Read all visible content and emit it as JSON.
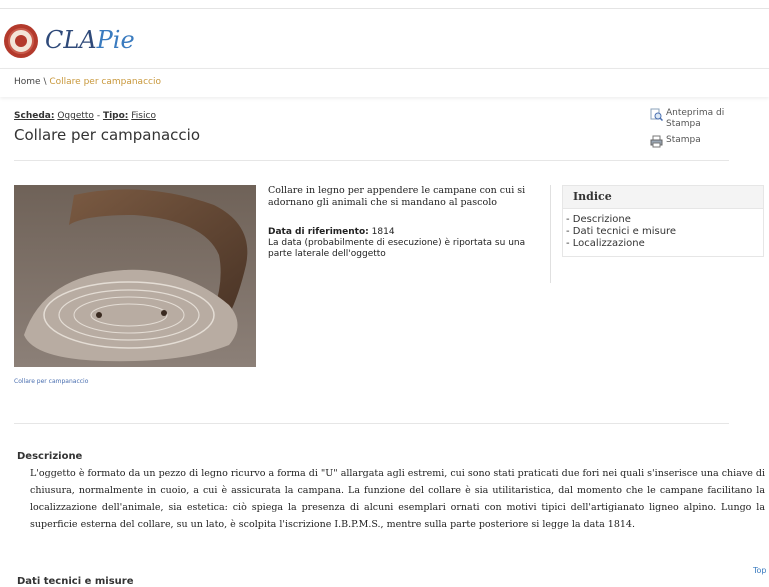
{
  "header": {
    "brand_prefix": "CLA",
    "brand_suffix": "Pie"
  },
  "breadcrumb": {
    "home": "Home",
    "separator": "\\",
    "current": "Collare per campanaccio"
  },
  "record": {
    "scheda_label": "Scheda:",
    "scheda_value": "Oggetto",
    "dash": "-",
    "tipo_label": "Tipo:",
    "tipo_value": "Fisico",
    "title": "Collare per campanaccio"
  },
  "actions": {
    "preview": "Anteprima di Stampa",
    "print": "Stampa"
  },
  "image": {
    "caption": "Collare per campanaccio"
  },
  "summary": {
    "description": "Collare in legno per appendere le campane con cui si adornano gli animali che si mandano al pascolo",
    "date_label": "Data di riferimento:",
    "date_value": "1814",
    "date_note": "La data (probabilmente di esecuzione) è riportata su una parte laterale dell'oggetto"
  },
  "index": {
    "title": "Indice",
    "items": [
      "- Descrizione",
      "- Dati tecnici e misure",
      "- Localizzazione"
    ]
  },
  "sections": {
    "descrizione_title": "Descrizione",
    "descrizione_body": "L'oggetto è formato da un pezzo di legno ricurvo a forma di \"U\" allargata agli estremi, cui sono stati praticati due fori nei quali s'inserisce una chiave di chiusura, normalmente in cuoio, a cui è assicurata la campana. La funzione del collare è sia utilitaristica, dal momento che le campane facilitano la localizzazione dell'animale, sia estetica: ciò spiega la presenza di alcuni esemplari ornati con motivi tipici dell'artigianato ligneo alpino. Lungo la superficie esterna del collare, su un lato, è scolpita l'iscrizione I.B.P.M.S., mentre sulla parte posteriore si legge la data 1814.",
    "top_link": "Top",
    "dati_title": "Dati tecnici e misure"
  }
}
